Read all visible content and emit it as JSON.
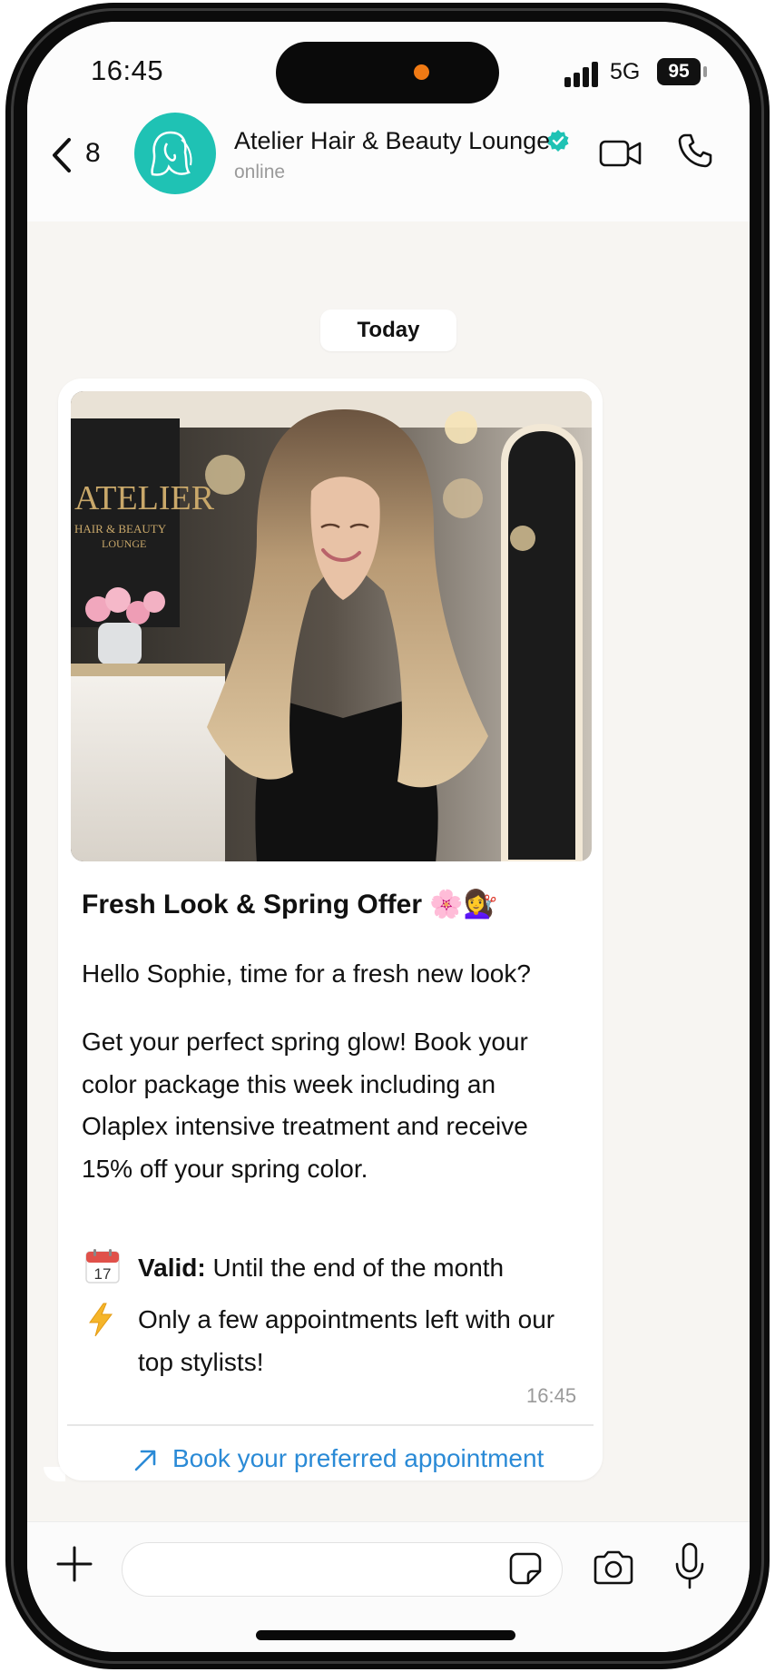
{
  "status_bar": {
    "time": "16:45",
    "network": "5G",
    "battery": "95"
  },
  "header": {
    "back_count": "8",
    "contact_name": "Atelier Hair & Beauty Lounge",
    "contact_status": "online"
  },
  "chat": {
    "date_label": "Today",
    "message": {
      "photo_sign_text": [
        "ATELIER",
        "HAIR & BEAUTY",
        "LOUNGE"
      ],
      "title": "Fresh Look & Spring Offer 🌸💇‍♀️",
      "greeting": "Hello Sophie, time for a fresh new look?",
      "body": "Get your perfect spring glow! Book your color package this week including an Olaplex intensive treatment and receive 15% off your spring color.",
      "calendar_icon_day": "17",
      "valid_label": "Valid:",
      "valid_text": " Until the end of the month",
      "urgency_text": "Only a few appointments left with our top stylists!",
      "time": "16:45",
      "cta_label": "Book your preferred appointment"
    }
  },
  "composer": {
    "value": "",
    "placeholder": ""
  },
  "colors": {
    "accent": "#1fc2b4",
    "link": "#2a8ad6",
    "chat_bg": "#f7f5f2",
    "offer_dot": "#f07a14"
  },
  "icons": [
    "back-icon",
    "verified-icon",
    "video-call-icon",
    "phone-call-icon",
    "calendar-icon",
    "lightning-icon",
    "arrow-up-right-icon",
    "plus-icon",
    "sticker-icon",
    "camera-icon",
    "microphone-icon"
  ]
}
